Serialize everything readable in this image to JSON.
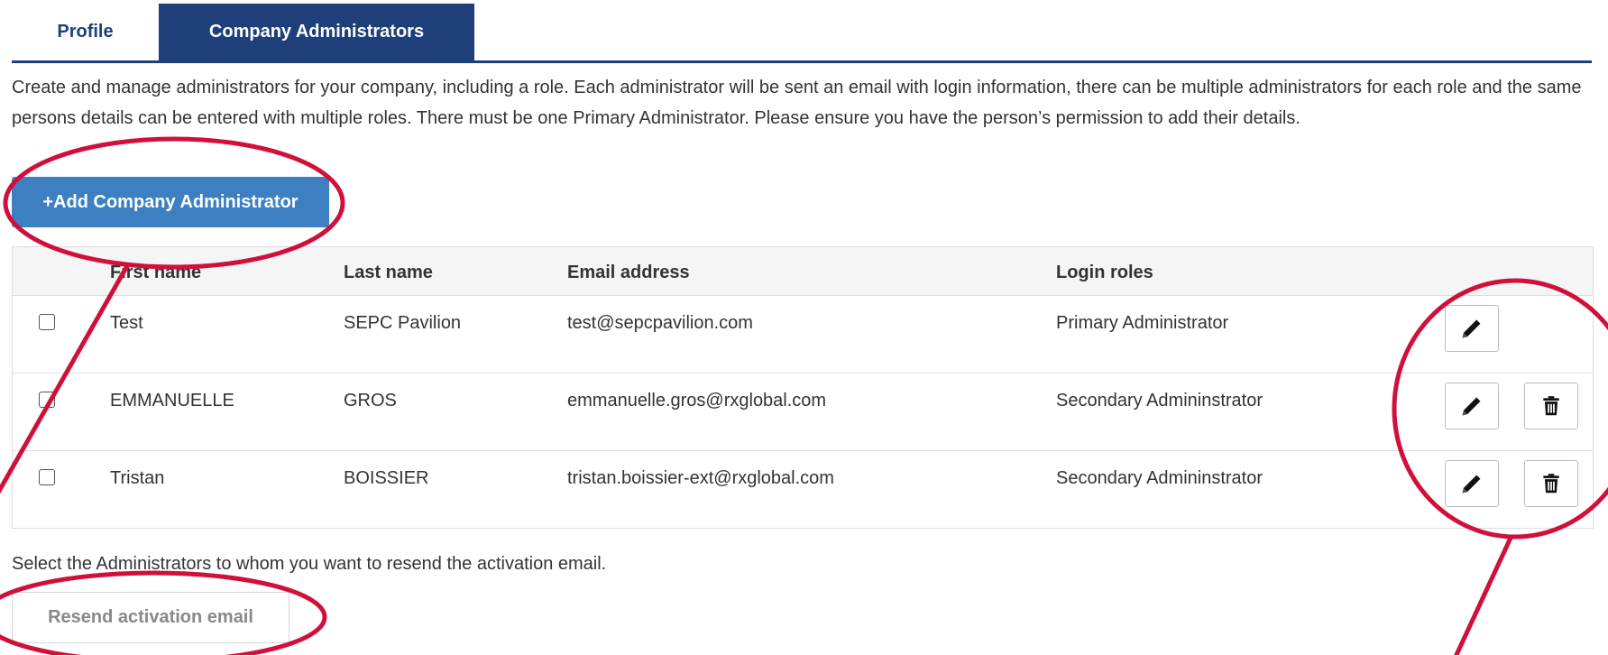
{
  "tabs": [
    {
      "label": "Profile",
      "active": false
    },
    {
      "label": "Company Administrators",
      "active": true
    }
  ],
  "description": "Create and manage administrators for your company, including a role. Each administrator will be sent an email with login information, there can be multiple administrators for each role and the same persons details can be entered with multiple roles. There must be one Primary Administrator. Please ensure you have the person’s permission to add their details.",
  "add_button_label": "+Add Company Administrator",
  "table": {
    "headers": [
      "First name",
      "Last name",
      "Email address",
      "Login roles"
    ],
    "rows": [
      {
        "first": "Test",
        "last": "SEPC Pavilion",
        "email": "test@sepcpavilion.com",
        "role": "Primary Administrator",
        "checked": false,
        "can_delete": false
      },
      {
        "first": "EMMANUELLE",
        "last": "GROS",
        "email": "emmanuelle.gros@rxglobal.com",
        "role": "Secondary Admininstrator",
        "checked": false,
        "can_delete": true
      },
      {
        "first": "Tristan",
        "last": "BOISSIER",
        "email": "tristan.boissier-ext@rxglobal.com",
        "role": "Secondary Admininstrator",
        "checked": false,
        "can_delete": true
      }
    ]
  },
  "resend_hint": "Select the Administrators to whom you want to resend the activation email.",
  "resend_button_label": "Resend activation email",
  "icons": {
    "edit": "pencil-icon",
    "delete": "trash-icon"
  },
  "colors": {
    "brand": "#1f3f7a",
    "button": "#3d80c2",
    "annotation": "#d0103a"
  }
}
